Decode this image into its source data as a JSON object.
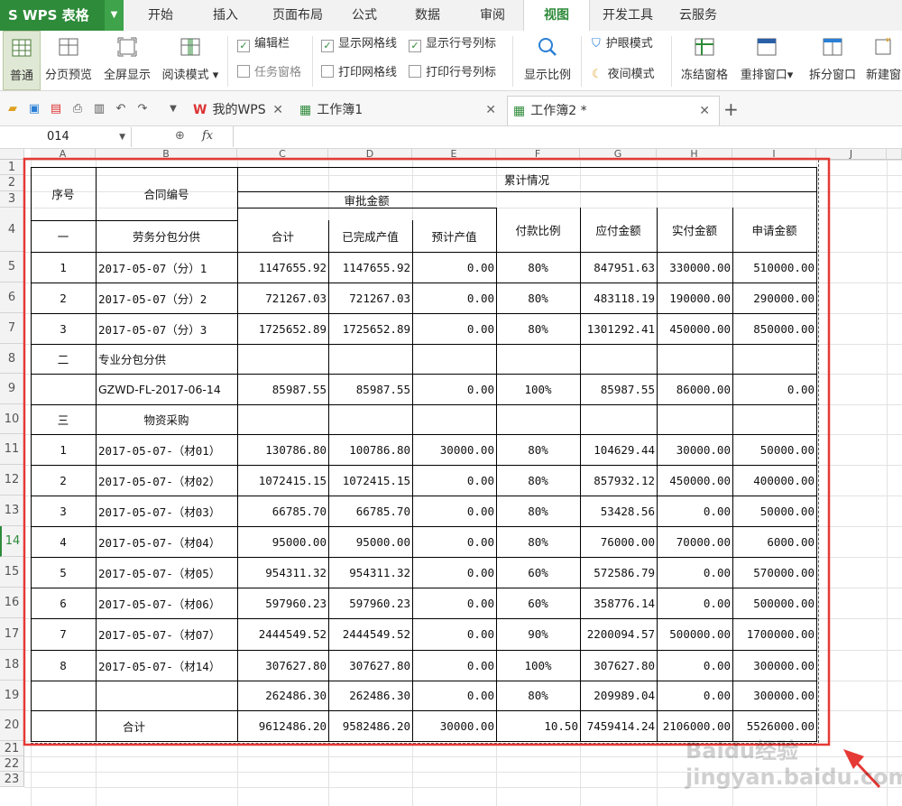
{
  "app": {
    "logo": "S WPS 表格",
    "menu_tabs": [
      "开始",
      "插入",
      "页面布局",
      "公式",
      "数据",
      "审阅",
      "视图",
      "开发工具",
      "云服务"
    ],
    "active_menu": "视图"
  },
  "ribbon": {
    "view_buttons": [
      "普通",
      "分页预览",
      "全屏显示",
      "阅读模式"
    ],
    "checks": [
      {
        "label": "编辑栏",
        "checked": true
      },
      {
        "label": "任务窗格",
        "checked": false
      },
      {
        "label": "显示网格线",
        "checked": true
      },
      {
        "label": "打印网格线",
        "checked": false
      },
      {
        "label": "显示行号列标",
        "checked": true
      },
      {
        "label": "打印行号列标",
        "checked": false
      }
    ],
    "zoom_label": "显示比例",
    "eye_mode": "护眼模式",
    "night_mode": "夜间模式",
    "right_buttons": [
      "冻结窗格",
      "重排窗口",
      "拆分窗口",
      "新建窗"
    ]
  },
  "doc_tabs": [
    {
      "label": "我的WPS"
    },
    {
      "label": "工作簿1"
    },
    {
      "label": "工作簿2 *"
    }
  ],
  "formula_bar": {
    "cell_ref": "014",
    "fx": "fx",
    "value": ""
  },
  "columns": [
    "A",
    "B",
    "C",
    "D",
    "E",
    "F",
    "G",
    "H",
    "I",
    "J"
  ],
  "rows": [
    "1",
    "2",
    "3",
    "4",
    "5",
    "6",
    "7",
    "8",
    "9",
    "10",
    "11",
    "12",
    "13",
    "14",
    "15",
    "16",
    "17",
    "18",
    "19",
    "20",
    "21",
    "22",
    "23"
  ],
  "headers": {
    "seq": "序号",
    "contract": "合同编号",
    "cumulative": "累计情况",
    "approved": "审批金额",
    "total": "合计",
    "completed": "已完成产值",
    "expected": "预计产值",
    "pay_ratio": "付款比例",
    "payable": "应付金额",
    "paid": "实付金额",
    "applied": "申请金额"
  },
  "table_rows": [
    [
      "一",
      "劳务分包分供",
      "",
      "",
      "",
      "",
      "",
      "",
      ""
    ],
    [
      "1",
      "2017-05-07（分）1",
      "1147655.92",
      "1147655.92",
      "0.00",
      "80%",
      "847951.63",
      "330000.00",
      "510000.00"
    ],
    [
      "2",
      "2017-05-07（分）2",
      "721267.03",
      "721267.03",
      "0.00",
      "80%",
      "483118.19",
      "190000.00",
      "290000.00"
    ],
    [
      "3",
      "2017-05-07（分）3",
      "1725652.89",
      "1725652.89",
      "0.00",
      "80%",
      "1301292.41",
      "450000.00",
      "850000.00"
    ],
    [
      "二",
      "专业分包分供",
      "",
      "",
      "",
      "",
      "",
      "",
      ""
    ],
    [
      "",
      "GZWD-FL-2017-06-14",
      "85987.55",
      "85987.55",
      "0.00",
      "100%",
      "85987.55",
      "86000.00",
      "0.00"
    ],
    [
      "三",
      "物资采购",
      "",
      "",
      "",
      "",
      "",
      "",
      ""
    ],
    [
      "1",
      "2017-05-07-（材01）",
      "130786.80",
      "100786.80",
      "30000.00",
      "80%",
      "104629.44",
      "30000.00",
      "50000.00"
    ],
    [
      "2",
      "2017-05-07-（材02）",
      "1072415.15",
      "1072415.15",
      "0.00",
      "80%",
      "857932.12",
      "450000.00",
      "400000.00"
    ],
    [
      "3",
      "2017-05-07-（材03）",
      "66785.70",
      "66785.70",
      "0.00",
      "80%",
      "53428.56",
      "0.00",
      "50000.00"
    ],
    [
      "4",
      "2017-05-07-（材04）",
      "95000.00",
      "95000.00",
      "0.00",
      "80%",
      "76000.00",
      "70000.00",
      "6000.00"
    ],
    [
      "5",
      "2017-05-07-（材05）",
      "954311.32",
      "954311.32",
      "0.00",
      "60%",
      "572586.79",
      "0.00",
      "570000.00"
    ],
    [
      "6",
      "2017-05-07-（材06）",
      "597960.23",
      "597960.23",
      "0.00",
      "60%",
      "358776.14",
      "0.00",
      "500000.00"
    ],
    [
      "7",
      "2017-05-07-（材07）",
      "2444549.52",
      "2444549.52",
      "0.00",
      "90%",
      "2200094.57",
      "500000.00",
      "1700000.00"
    ],
    [
      "8",
      "2017-05-07-（材14）",
      "307627.80",
      "307627.80",
      "0.00",
      "100%",
      "307627.80",
      "0.00",
      "300000.00"
    ],
    [
      "",
      "",
      "262486.30",
      "262486.30",
      "0.00",
      "80%",
      "209989.04",
      "0.00",
      "300000.00"
    ],
    [
      "合计",
      "",
      "9612486.20",
      "9582486.20",
      "30000.00",
      "10.50",
      "7459414.24",
      "2106000.00",
      "5526000.00"
    ]
  ],
  "watermark": "Baidu经验 jingyan.baidu.com",
  "accent_color": "#2e8b3a",
  "highlight_color": "#e53935"
}
